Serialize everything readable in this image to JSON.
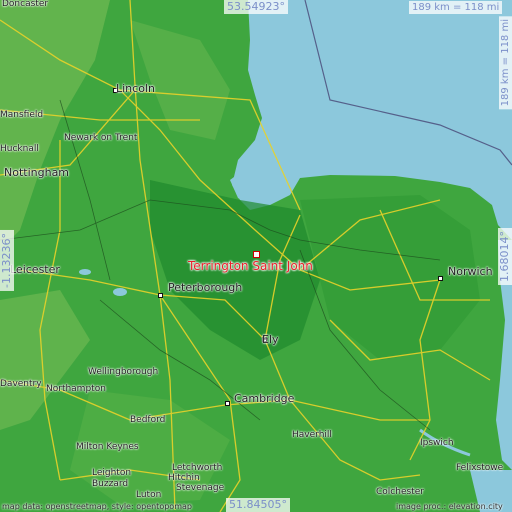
{
  "marker": {
    "name": "Terrington Saint John",
    "color": "#e8202a"
  },
  "coords": {
    "north": "53.54923°",
    "south": "51.84505°",
    "west": "-1.13236°",
    "east": "1.68014°"
  },
  "scale": {
    "horizontal": "189 km = 118 mi",
    "vertical": "189 km = 118 mi"
  },
  "attribution": {
    "left": "map data: openstreetmap, style: opentopomap",
    "right": "image proc.: elevation.city"
  },
  "colors": {
    "sea": "#8cc8dc",
    "land": "#3fa63f",
    "highland": "#7fbf5a",
    "lowland": "#1f8a2e",
    "roads": "#e8d22a"
  },
  "places": [
    {
      "name": "Doncaster",
      "size": "small"
    },
    {
      "name": "Lincoln",
      "size": "big"
    },
    {
      "name": "Mansfield",
      "size": "small"
    },
    {
      "name": "Newark on Trent",
      "size": "small"
    },
    {
      "name": "Hucknall",
      "size": "small"
    },
    {
      "name": "Nottingham",
      "size": "big"
    },
    {
      "name": "Leicester",
      "size": "big"
    },
    {
      "name": "Peterborough",
      "size": "big"
    },
    {
      "name": "Norwich",
      "size": "big"
    },
    {
      "name": "Ely",
      "size": "big"
    },
    {
      "name": "Wellingborough",
      "size": "small"
    },
    {
      "name": "Daventry",
      "size": "small"
    },
    {
      "name": "Northampton",
      "size": "small"
    },
    {
      "name": "Bedford",
      "size": "small"
    },
    {
      "name": "Cambridge",
      "size": "big"
    },
    {
      "name": "Haverhill",
      "size": "small"
    },
    {
      "name": "Milton Keynes",
      "size": "small"
    },
    {
      "name": "Leighton Buzzard",
      "size": "small"
    },
    {
      "name": "Letchworth",
      "size": "small"
    },
    {
      "name": "Hitchin",
      "size": "small"
    },
    {
      "name": "Stevenage",
      "size": "small"
    },
    {
      "name": "Luton",
      "size": "small"
    },
    {
      "name": "Ipswich",
      "size": "small"
    },
    {
      "name": "Felixstowe",
      "size": "small"
    },
    {
      "name": "Colchester",
      "size": "small"
    }
  ]
}
